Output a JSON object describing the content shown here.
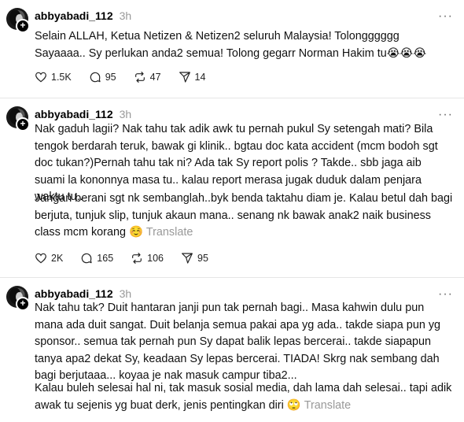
{
  "posts": [
    {
      "username": "abbyabadi_112",
      "time": "3h",
      "paragraphs": [
        "Selain ALLAH, Ketua Netizen & Netizen2 seluruh Malaysia! Tolongggggg Sayaaaa.. Sy perlukan anda2 semua! Tolong gegarr Norman Hakim tu😭😭😭"
      ],
      "likes": "1.5K",
      "replies": "95",
      "reposts": "47",
      "shares": "14"
    },
    {
      "username": "abbyabadi_112",
      "time": "3h",
      "paragraphs": [
        "Nak gaduh lagii? Nak tahu tak adik awk tu pernah pukul Sy setengah mati? Bila tengok berdarah teruk, bawak gi klinik.. bgtau doc kata accident (mcm bodoh sgt doc tukan?)Pernah tahu tak ni? Ada tak Sy report polis ? Takde.. sbb jaga aib suami la kononnya masa tu.. kalau report merasa jugak duduk dalam penjara waktu tu..",
        "Jangan berani sgt nk sembanglah..byk benda taktahu diam je. Kalau betul dah bagi berjuta, tunjuk slip, tunjuk akaun mana.. senang nk bawak anak2 naik business class mcm korang ☺️"
      ],
      "translate": "Translate",
      "likes": "2K",
      "replies": "165",
      "reposts": "106",
      "shares": "95"
    },
    {
      "username": "abbyabadi_112",
      "time": "3h",
      "paragraphs": [
        "Nak tahu tak? Duit hantaran janji pun tak pernah bagi.. Masa kahwin dulu pun mana ada duit sangat. Duit belanja semua pakai apa yg ada.. takde siapa pun yg sponsor.. semua tak pernah pun Sy dapat balik lepas bercerai.. takde siapapun tanya apa2 dekat Sy, keadaan Sy lepas bercerai. TIADA! Skrg nak sembang dah bagi berjutaaa... koyaa je nak masuk campur tiba2...",
        "Kalau buleh selesai hal ni, tak masuk sosial media, dah lama dah selesai.. tapi adik awak tu sejenis yg buat derk, jenis pentingkan diri 🙄"
      ],
      "translate": "Translate"
    }
  ],
  "more_icon": "more-dots-icon"
}
